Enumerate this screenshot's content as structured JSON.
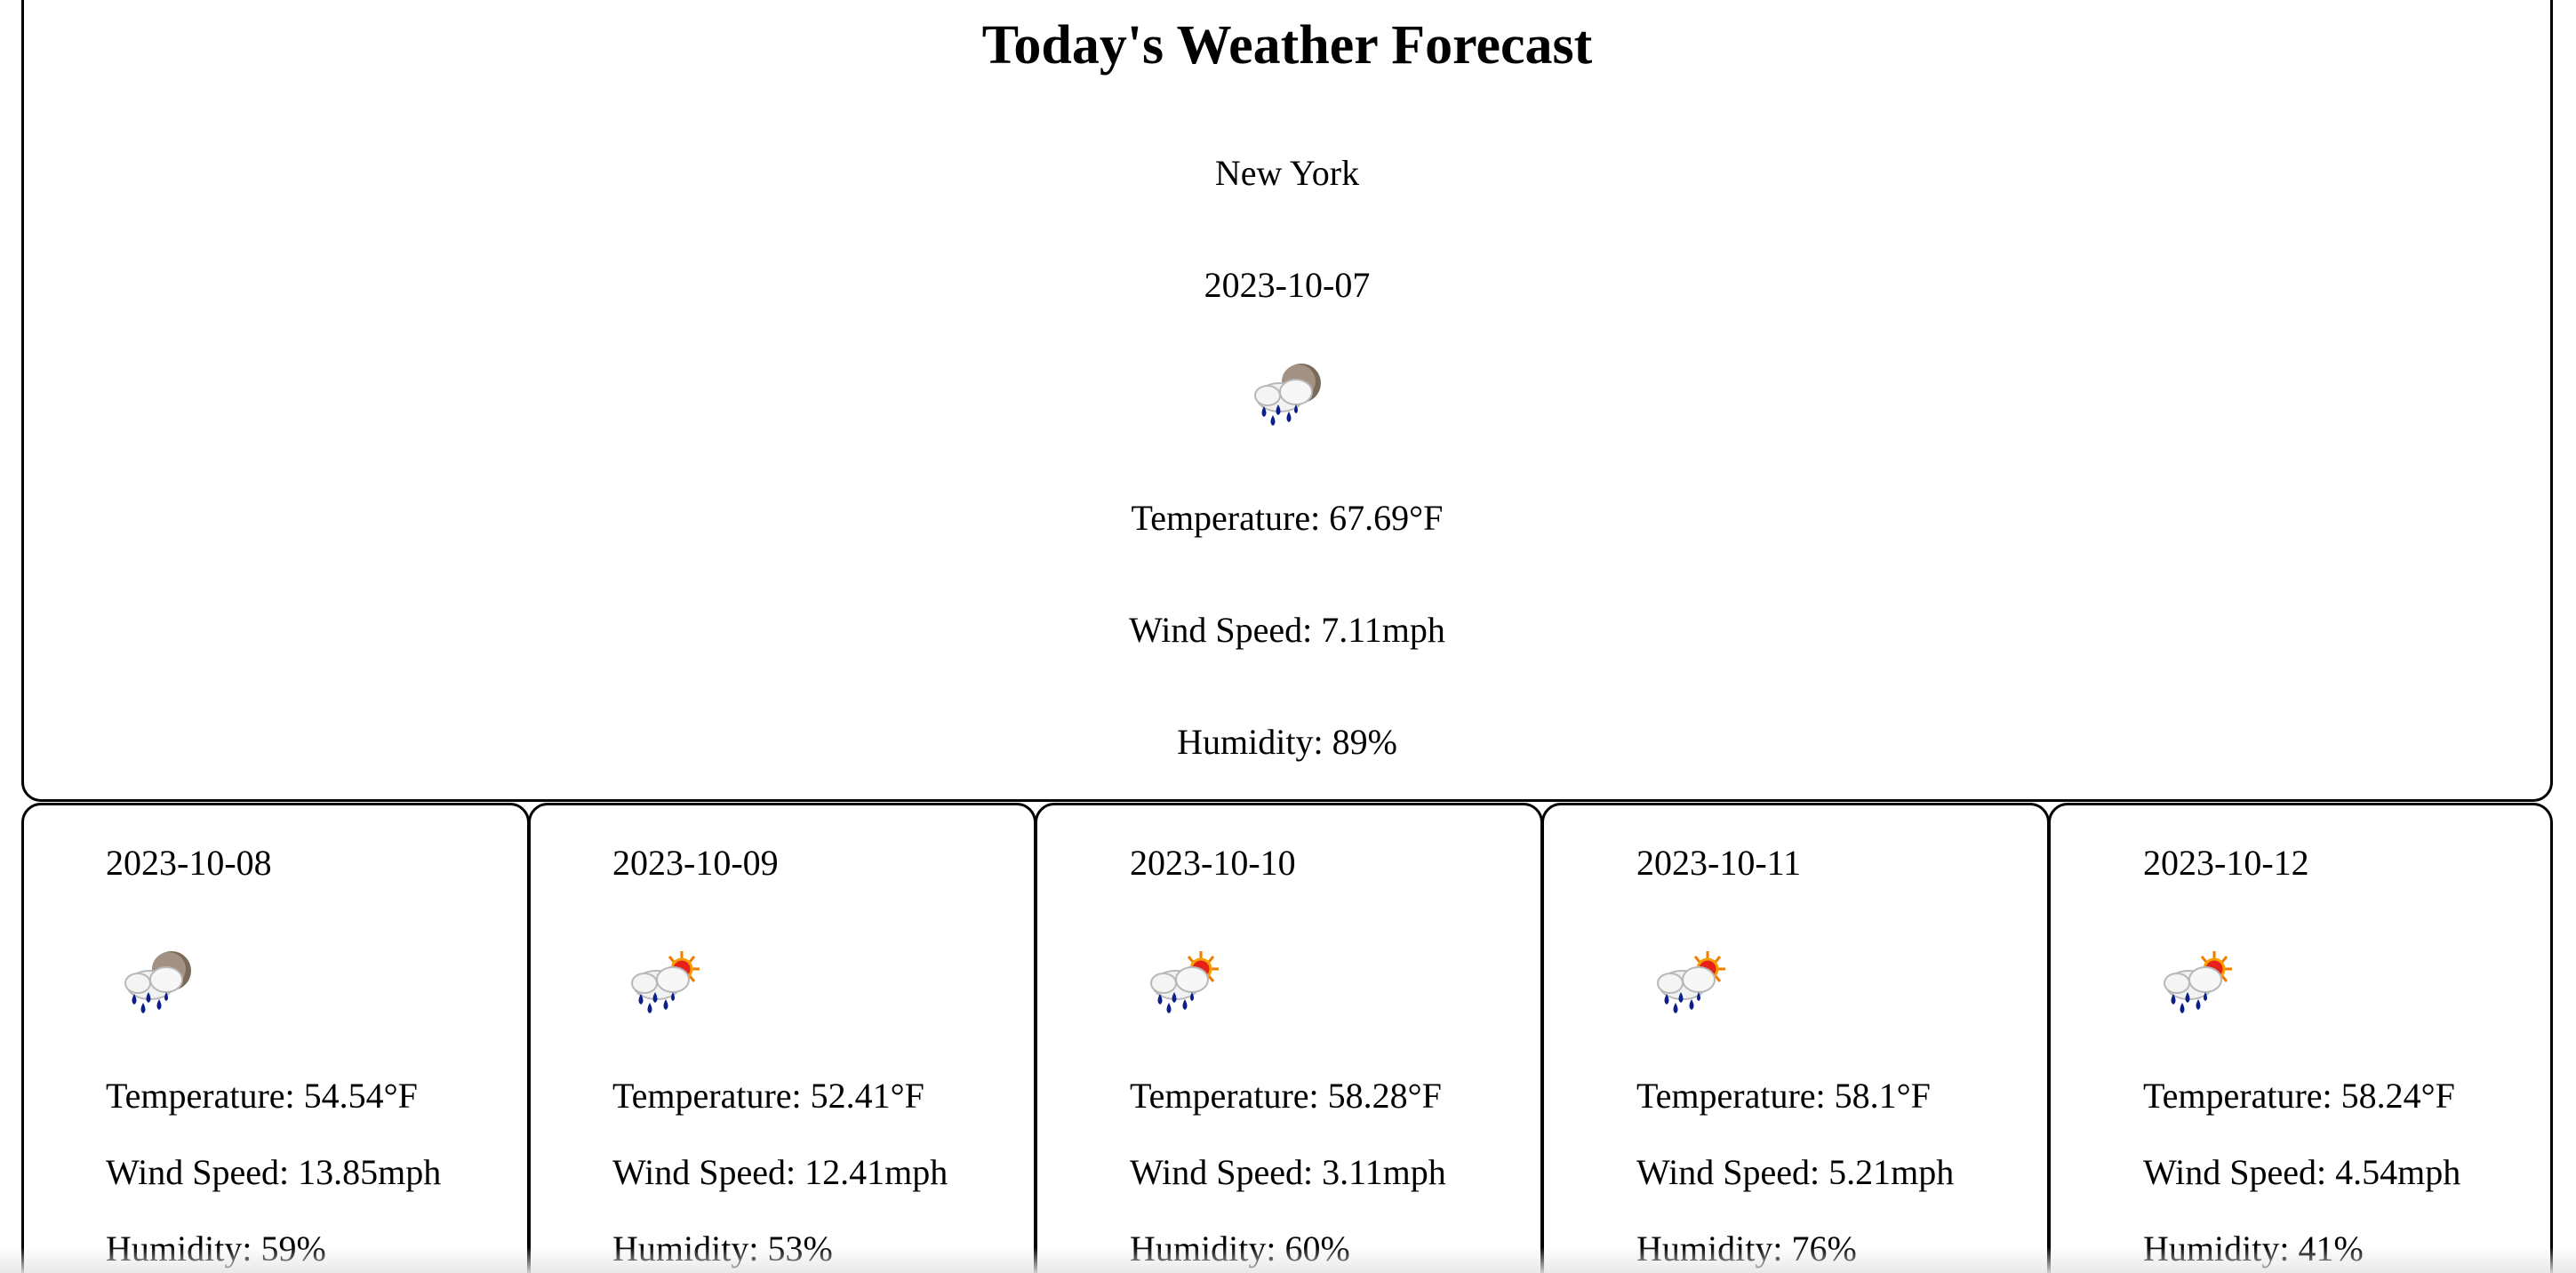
{
  "today": {
    "title": "Today's Weather Forecast",
    "city": "New York",
    "date": "2023-10-07",
    "icon": "rain-cloud-night-icon",
    "temperature": "Temperature: 67.69°F",
    "wind": "Wind Speed: 7.11mph",
    "humidity": "Humidity: 89%"
  },
  "forecast": [
    {
      "date": "2023-10-08",
      "icon": "rain-cloud-night-icon",
      "temperature": "Temperature: 54.54°F",
      "wind": "Wind Speed: 13.85mph",
      "humidity": "Humidity: 59%"
    },
    {
      "date": "2023-10-09",
      "icon": "rain-cloud-sun-icon",
      "temperature": "Temperature: 52.41°F",
      "wind": "Wind Speed: 12.41mph",
      "humidity": "Humidity: 53%"
    },
    {
      "date": "2023-10-10",
      "icon": "rain-cloud-sun-icon",
      "temperature": "Temperature: 58.28°F",
      "wind": "Wind Speed: 3.11mph",
      "humidity": "Humidity: 60%"
    },
    {
      "date": "2023-10-11",
      "icon": "rain-cloud-sun-icon",
      "temperature": "Temperature: 58.1°F",
      "wind": "Wind Speed: 5.21mph",
      "humidity": "Humidity: 76%"
    },
    {
      "date": "2023-10-12",
      "icon": "rain-cloud-sun-icon",
      "temperature": "Temperature: 58.24°F",
      "wind": "Wind Speed: 4.54mph",
      "humidity": "Humidity: 41%"
    }
  ]
}
